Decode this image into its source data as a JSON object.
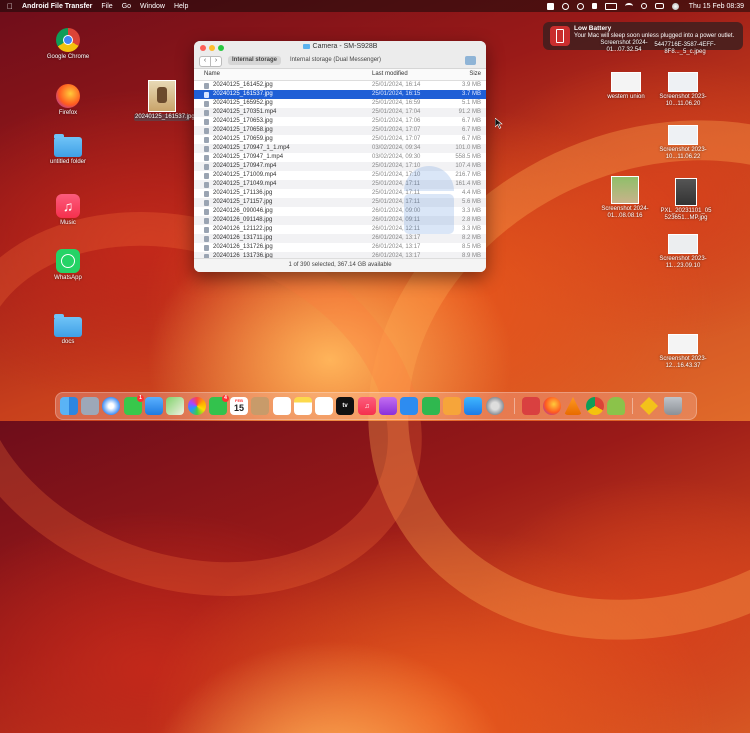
{
  "menubar": {
    "app_name": "Android File Transfer",
    "items": [
      "File",
      "Go",
      "Window",
      "Help"
    ],
    "clock": "Thu 15 Feb  08:39"
  },
  "notification": {
    "title": "Low Battery",
    "body": "Your Mac will sleep soon unless plugged into a power outlet."
  },
  "desktop_left": [
    {
      "label": "Google Chrome",
      "icon": "chrome-icon"
    },
    {
      "label": "Firefox",
      "icon": "firefox-icon"
    },
    {
      "label": "untitled folder",
      "icon": "folder-icon"
    },
    {
      "label": "Music",
      "icon": "music-icon"
    },
    {
      "label": "WhatsApp",
      "icon": "whatsapp-icon"
    },
    {
      "label": "docs",
      "icon": "folder-icon"
    }
  ],
  "dragged_file": {
    "label": "20240125_161537.jpg"
  },
  "desktop_right": [
    {
      "label": "Screenshot 2024-01...07.32.54"
    },
    {
      "label": "5447716E-3587-4EFF-8F8..._5_c.jpeg"
    },
    {
      "label": "western union"
    },
    {
      "label": "Screenshot 2023-10...11.06.20"
    },
    {
      "label": "Screenshot 2023-10...11.06.22"
    },
    {
      "label": "Screenshot 2024-01...08.08.16"
    },
    {
      "label": "PXL_20231101_05 523651...MP.jpg"
    },
    {
      "label": "Screenshot 2023-11...23.09.10"
    },
    {
      "label": "Screenshot 2023-12...16.43.37"
    }
  ],
  "window": {
    "title": "Camera - SM-S928B",
    "tabs": [
      "Internal storage",
      "Internal storage (Dual Messenger)"
    ],
    "columns": {
      "name": "Name",
      "modified": "Last modified",
      "size": "Size"
    },
    "files": [
      {
        "name": "20240125_161452.jpg",
        "date": "25/01/2024, 16:14",
        "size": "3.9 MB"
      },
      {
        "name": "20240125_161537.jpg",
        "date": "25/01/2024, 16:15",
        "size": "3.7 MB"
      },
      {
        "name": "20240125_165952.jpg",
        "date": "25/01/2024, 16:59",
        "size": "5.1 MB"
      },
      {
        "name": "20240125_170351.mp4",
        "date": "25/01/2024, 17:04",
        "size": "91.2 MB"
      },
      {
        "name": "20240125_170653.jpg",
        "date": "25/01/2024, 17:06",
        "size": "6.7 MB"
      },
      {
        "name": "20240125_170658.jpg",
        "date": "25/01/2024, 17:07",
        "size": "6.7 MB"
      },
      {
        "name": "20240125_170659.jpg",
        "date": "25/01/2024, 17:07",
        "size": "6.7 MB"
      },
      {
        "name": "20240125_170947_1_1.mp4",
        "date": "03/02/2024, 09:34",
        "size": "101.0 MB"
      },
      {
        "name": "20240125_170947_1.mp4",
        "date": "03/02/2024, 09:30",
        "size": "558.5 MB"
      },
      {
        "name": "20240125_170947.mp4",
        "date": "25/01/2024, 17:10",
        "size": "107.4 MB"
      },
      {
        "name": "20240125_171009.mp4",
        "date": "25/01/2024, 17:10",
        "size": "216.7 MB"
      },
      {
        "name": "20240125_171049.mp4",
        "date": "25/01/2024, 17:11",
        "size": "161.4 MB"
      },
      {
        "name": "20240125_171136.jpg",
        "date": "25/01/2024, 17:11",
        "size": "4.4 MB"
      },
      {
        "name": "20240125_171157.jpg",
        "date": "25/01/2024, 17:11",
        "size": "5.6 MB"
      },
      {
        "name": "20240126_090046.jpg",
        "date": "26/01/2024, 09:00",
        "size": "3.3 MB"
      },
      {
        "name": "20240126_091148.jpg",
        "date": "26/01/2024, 09:11",
        "size": "2.8 MB"
      },
      {
        "name": "20240126_121122.jpg",
        "date": "26/01/2024, 12:11",
        "size": "3.3 MB"
      },
      {
        "name": "20240126_131711.jpg",
        "date": "26/01/2024, 13:17",
        "size": "8.2 MB"
      },
      {
        "name": "20240126_131726.jpg",
        "date": "26/01/2024, 13:17",
        "size": "8.5 MB"
      },
      {
        "name": "20240126_131736.jpg",
        "date": "26/01/2024, 13:17",
        "size": "8.9 MB"
      }
    ],
    "status": "1 of 390 selected, 367.14 GB available"
  },
  "dock": {
    "calendar_month": "FEB",
    "calendar_day": "15",
    "tv_label": "tv",
    "messages_badge": "1",
    "reminders_badge": "4"
  }
}
